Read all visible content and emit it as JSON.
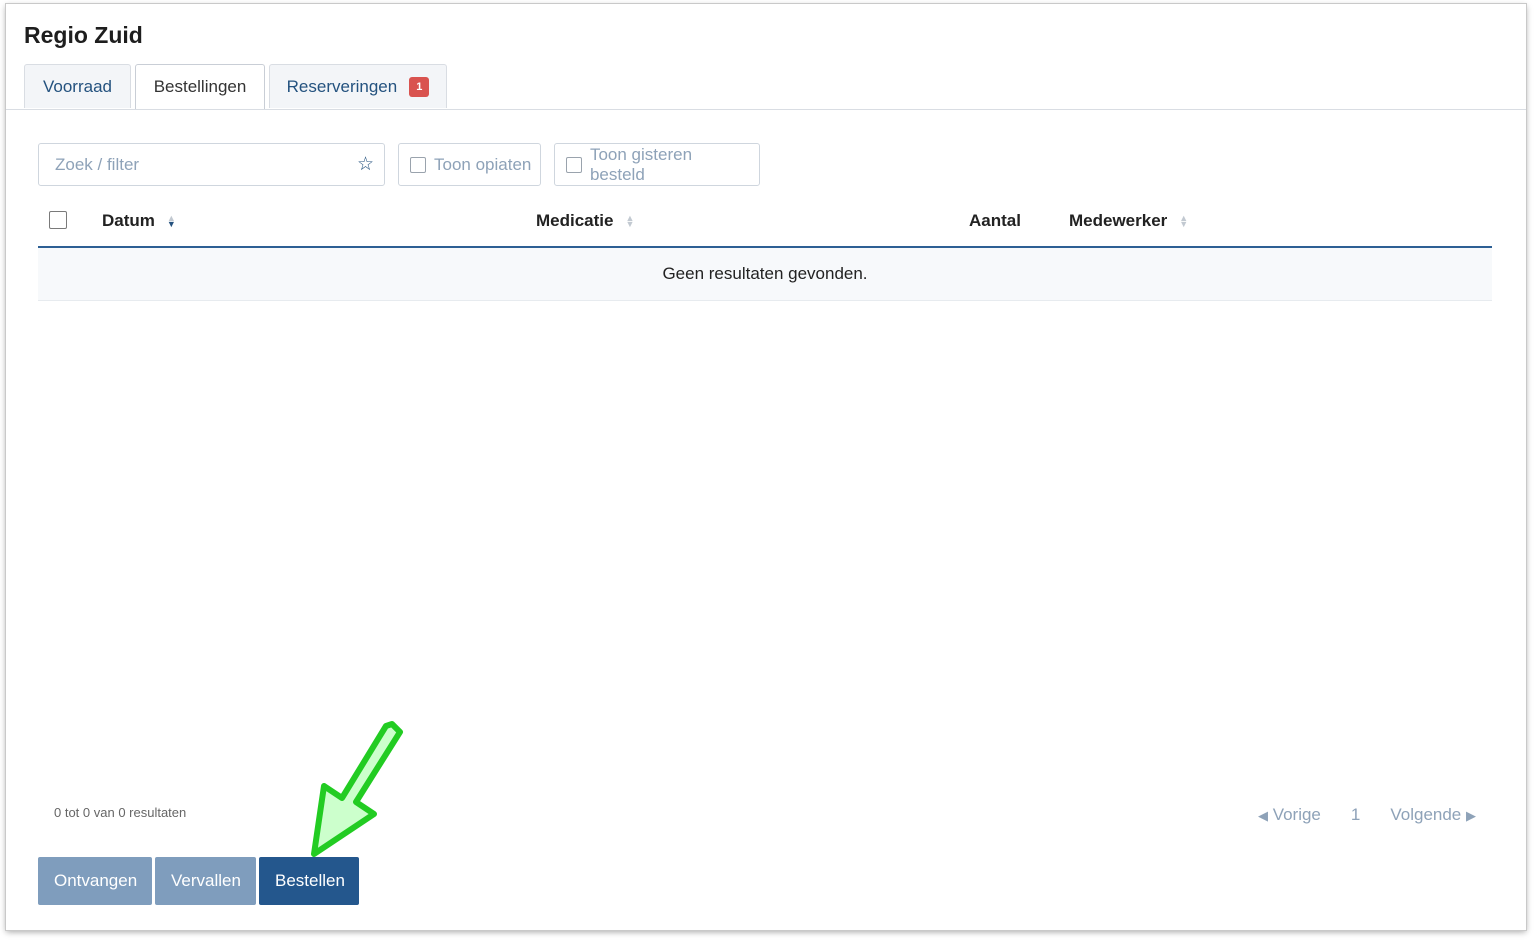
{
  "page": {
    "title": "Regio Zuid"
  },
  "tabs": [
    {
      "label": "Voorraad",
      "active": false
    },
    {
      "label": "Bestellingen",
      "active": true
    },
    {
      "label": "Reserveringen",
      "active": false,
      "badge": "1"
    }
  ],
  "filters": {
    "search_placeholder": "Zoek / filter",
    "star_icon": "star-icon",
    "show_opiates": "Toon opiaten",
    "show_ordered_yesterday": "Toon gisteren besteld"
  },
  "table": {
    "columns": [
      "Datum",
      "Medicatie",
      "Aantal",
      "Medewerker"
    ],
    "sorted_column": "Datum",
    "empty_text": "Geen resultaten gevonden."
  },
  "footer": {
    "info": "0 tot 0 van 0 resultaten",
    "prev": "Vorige",
    "page": "1",
    "next": "Volgende"
  },
  "actions": {
    "receive": "Ontvangen",
    "expire": "Vervallen",
    "order": "Bestellen"
  },
  "colors": {
    "primary": "#24578d",
    "muted": "#7f9dbd",
    "badge": "#d9534f",
    "annotation_arrow": "#22cc22"
  }
}
